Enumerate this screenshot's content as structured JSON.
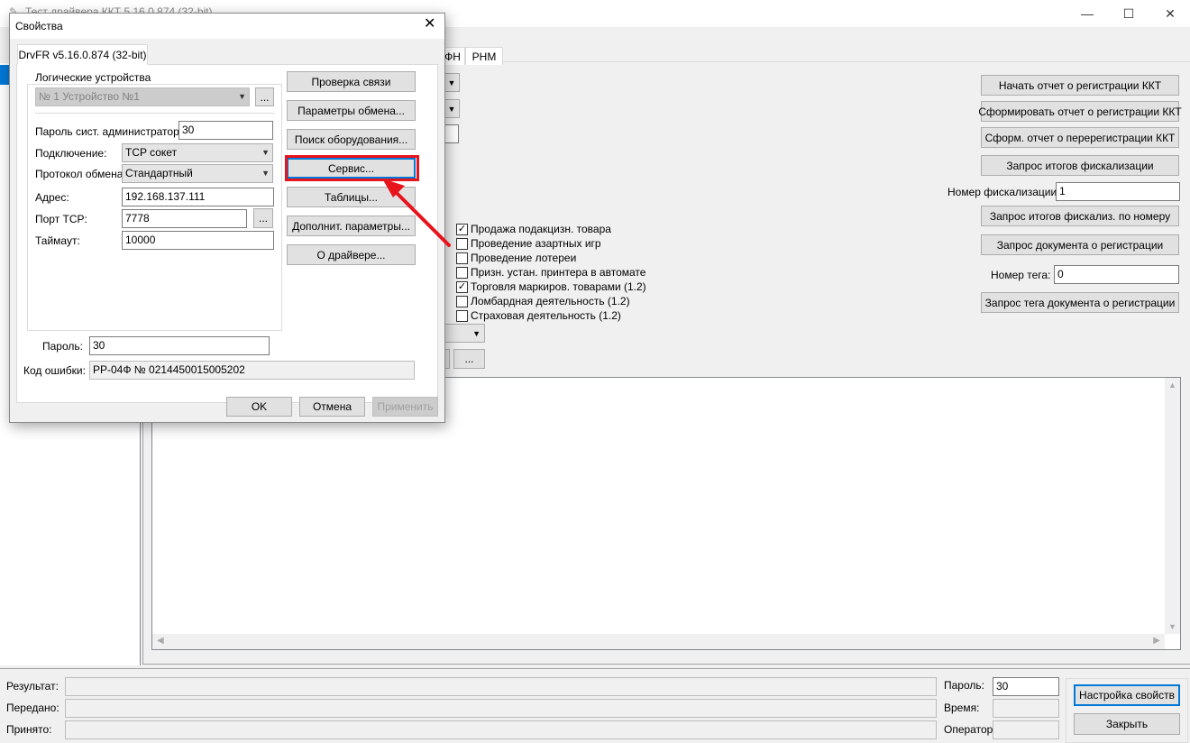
{
  "main_window": {
    "title": "Тест драйвера ККТ 5.16.0.874 (32-bit)",
    "tabs": [
      "ФН",
      "РНМ"
    ],
    "right_buttons": [
      "Начать отчет о регистрации ККТ",
      "Сформировать отчет о регистрации ККТ",
      "Сформ. отчет о перерегистрации ККТ",
      "Запрос итогов фискализации",
      "Запрос итогов фискализ. по номеру",
      "Запрос документа о регистрации",
      "Запрос тега документа о регистрации"
    ],
    "fiscal_number_label": "Номер фискализации:",
    "fiscal_number_value": "1",
    "tag_number_label": "Номер тега:",
    "tag_number_value": "0",
    "checkboxes": [
      {
        "label": "Продажа подакцизн. товара",
        "checked": true
      },
      {
        "label": "Проведение азартных игр",
        "checked": false
      },
      {
        "label": "Проведение лотереи",
        "checked": false
      },
      {
        "label": "Призн. устан. принтера в автомате",
        "checked": false
      },
      {
        "label": "Торговля маркиров. товарами (1.2)",
        "checked": true
      },
      {
        "label": "Ломбардная деятельность (1.2)",
        "checked": false
      },
      {
        "label": "Страховая деятельность (1.2)",
        "checked": false
      }
    ],
    "small_button_label": "...",
    "status": {
      "result_label": "Результат:",
      "sent_label": "Передано:",
      "received_label": "Принято:",
      "password_label": "Пароль:",
      "password_value": "30",
      "time_label": "Время:",
      "operator_label": "Оператор:",
      "settings_button": "Настройка свойств",
      "close_button": "Закрыть"
    }
  },
  "dialog": {
    "title": "Свойства",
    "close_glyph": "✕",
    "tab": "DrvFR v5.16.0.874 (32-bit)",
    "logical_devices_label": "Логические устройства",
    "logical_device_value": "№ 1 Устройство №1",
    "admin_password_label": "Пароль сист. администратора:",
    "admin_password_value": "30",
    "connection_label": "Подключение:",
    "connection_value": "TCP сокет",
    "protocol_label": "Протокол обмена:",
    "protocol_value": "Стандартный",
    "address_label": "Адрес:",
    "address_value": "192.168.137.111",
    "port_label": "Порт TCP:",
    "port_value": "7778",
    "timeout_label": "Таймаут:",
    "timeout_value": "10000",
    "password_label": "Пароль:",
    "password_value": "30",
    "error_code_label": "Код ошибки:",
    "error_code_value": "РР-04Ф № 0214450015005202",
    "ellipsis": "...",
    "side_buttons": [
      "Проверка связи",
      "Параметры обмена...",
      "Поиск оборудования...",
      "Сервис...",
      "Таблицы...",
      "Дополнит. параметры...",
      "О драйвере..."
    ],
    "ok_button": "OK",
    "cancel_button": "Отмена",
    "apply_button": "Применить"
  },
  "colors": {
    "highlight": "#e8141b",
    "focus": "#0078d7",
    "accent_strip": "#0078d7"
  }
}
